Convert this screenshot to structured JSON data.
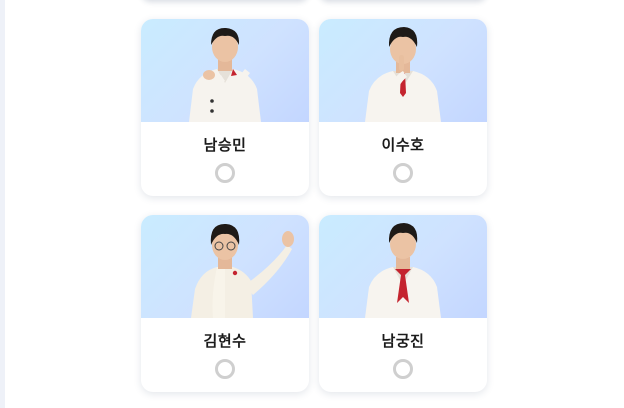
{
  "candidates": [
    {
      "name": "남승민"
    },
    {
      "name": "이수호"
    },
    {
      "name": "김현수"
    },
    {
      "name": "남궁진"
    }
  ]
}
